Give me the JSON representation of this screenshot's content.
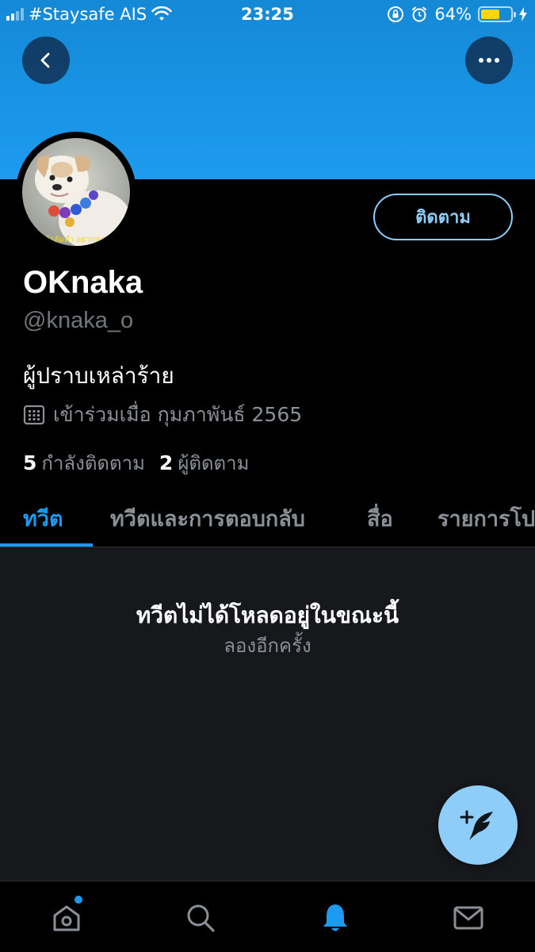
{
  "status_bar": {
    "carrier": "#Staysafe AIS",
    "time": "23:25",
    "battery_percent": "64%",
    "battery_level": 0.64,
    "battery_color": "#ffd60a"
  },
  "header": {
    "back_icon": "chevron-left-icon",
    "more_icon": "more-horizontal-icon",
    "banner_color": "#1d9bf0"
  },
  "profile": {
    "display_name": "OKnaka",
    "handle": "@knaka_o",
    "bio": "ผู้ปราบเหล่าร้าย",
    "joined": "เข้าร่วมเมื่อ กุมภาพันธ์ 2565",
    "following_count": "5",
    "following_label": "กำลังติดตาม",
    "followers_count": "2",
    "followers_label": "ผู้ติดตาม",
    "follow_button_label": "ติดตาม",
    "avatar_caption": "เจ้าส้มตำ อยากหล่อ"
  },
  "tabs": [
    {
      "label": "ทวีต",
      "active": true
    },
    {
      "label": "ทวีตและการตอบกลับ",
      "active": false
    },
    {
      "label": "สื่อ",
      "active": false
    },
    {
      "label": "รายการโปรด",
      "active": false
    }
  ],
  "feed": {
    "empty_title": "ทวีตไม่ได้โหลดอยู่ในขณะนี้",
    "retry_label": "ลองอีกครั้ง"
  },
  "compose_icon": "compose-tweet-icon",
  "bottom_nav": [
    {
      "icon": "home-icon",
      "has_dot": true
    },
    {
      "icon": "search-icon"
    },
    {
      "icon": "bell-icon",
      "active": true
    },
    {
      "icon": "mail-icon"
    }
  ],
  "accent_color": "#1d9bf0"
}
